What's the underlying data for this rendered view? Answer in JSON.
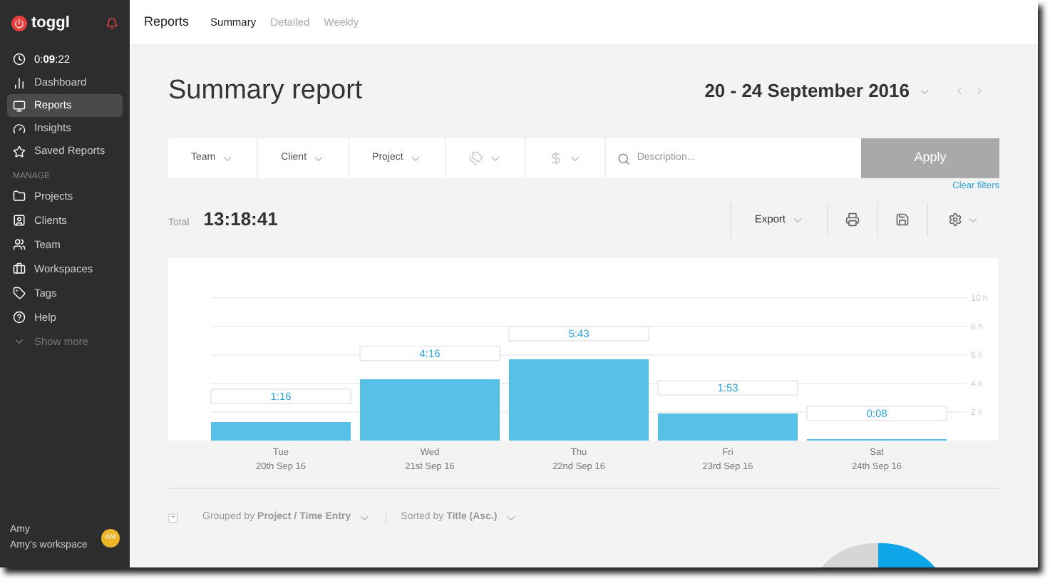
{
  "sidebar": {
    "logo": "toggl",
    "timer": "0:**09**:22",
    "items": [
      {
        "label": "Dashboard",
        "selected": false
      },
      {
        "label": "Reports",
        "selected": true
      },
      {
        "label": "Insights",
        "selected": false
      },
      {
        "label": "Saved Reports",
        "selected": false
      }
    ],
    "section": "MANAGE",
    "manage": [
      {
        "label": "Projects"
      },
      {
        "label": "Clients"
      },
      {
        "label": "Team"
      },
      {
        "label": "Workspaces"
      },
      {
        "label": "Tags"
      },
      {
        "label": "Help"
      }
    ],
    "show_more": "Show more",
    "user": {
      "name": "Amy",
      "workspace": "Amy's workspace",
      "initials": "AM"
    }
  },
  "header": {
    "title": "Reports",
    "tabs": [
      {
        "label": "Summary",
        "selected": true
      },
      {
        "label": "Detailed",
        "selected": false
      },
      {
        "label": "Weekly",
        "selected": false
      }
    ]
  },
  "page_title": "Summary report",
  "date_range": "20 - 24 September 2016",
  "filters": {
    "items": [
      {
        "label": "Team",
        "kind": "text"
      },
      {
        "label": "Client",
        "kind": "text"
      },
      {
        "label": "Project",
        "kind": "text"
      },
      {
        "kind": "tag"
      },
      {
        "kind": "dollar"
      }
    ],
    "placeholder": "Description...",
    "apply": "Apply",
    "clear": "Clear filters"
  },
  "total": {
    "label": "Total",
    "value": "13:18:41"
  },
  "export": "Export",
  "chart": {
    "dates": [
      "20th Sep 16",
      "21st Sep 16",
      "22nd Sep 16",
      "23rd Sep 16",
      "24th Sep 16"
    ],
    "chart_data": {
      "type": "bar",
      "categories": [
        "Tue",
        "Wed",
        "Thu",
        "Fri",
        "Sat"
      ],
      "series": [
        {
          "color": "#56c0e6",
          "values": [
            1.3,
            4.3,
            5.7,
            1.9,
            0.1
          ]
        }
      ],
      "grid": true,
      "ylim": [
        0,
        10
      ],
      "yticks": [
        {
          "value": 2,
          "label": "2 h"
        },
        {
          "value": 4,
          "label": "4 h"
        },
        {
          "value": 6,
          "label": "6 h"
        },
        {
          "value": 8,
          "label": "8 h"
        },
        {
          "value": 10,
          "label": "10 h"
        }
      ],
      "value_labels": [
        "1:16",
        "4:16",
        "5:43",
        "1:53",
        "0:08"
      ]
    }
  },
  "grouping": {
    "expand": "+",
    "grouped": "Grouped by **Project / Time Entry**",
    "sorted": "Sorted by **Title (Asc.)**"
  }
}
